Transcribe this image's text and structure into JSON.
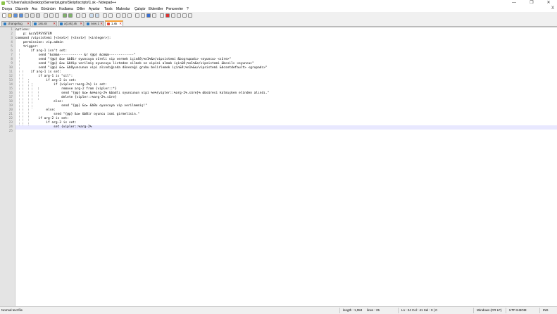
{
  "window": {
    "title": "*C:\\Users\\alica\\Desktop\\Server\\plugins\\Skript\\scripts\\1.sk - Notepad++",
    "minimize": "—",
    "maximize": "❐",
    "close": "✕"
  },
  "menu": {
    "items": [
      "Dosya",
      "Düzenle",
      "Ara",
      "Görünüm",
      "Kodlama",
      "Diller",
      "Ayarlar",
      "Tools",
      "Makrolar",
      "Çalıştır",
      "Eklentiler",
      "Pencereler",
      "?"
    ],
    "close_label": "X"
  },
  "tabs": [
    {
      "label": "changelog"
    },
    {
      "label": "1sk.sk"
    },
    {
      "label": "a(1sk).sk"
    },
    {
      "label": "new 1"
    },
    {
      "label": "1.sk"
    }
  ],
  "editor": {
    "lines": [
      "options:",
      "    p: &ccVIPSYSTEM",
      "command /vipsistemi [<text>] [<text>] [<integer>]:",
      "    permission: vip.admin",
      "    trigger:",
      "        if arg-1 isn't set:",
      "            send \"&cm&m------------ &r {@p} &cm&m-------------\"",
      "            send \"{@p} &c► &bBir oyuncuya süreli vip vermek için&9;%n1%&e/vipsistemi &bcgrupadı> <oyuncu> <süre>\"",
      "            send \"{@p} &c► &bVip verilmiş oyuncuyu listeden silmek ve vipini almak için&9;%n1%&e/vipsistemi &bcsil> <oyuncu>\"",
      "            send \"{@p} &c► &bOyuncunun vipi alındığında döneceği grubu belirlemek için&9;%n1%&e/vipsistemi &bcsetdefault> <grupadı>\"",
      "        if arg-1 is set:",
      "            if arg-1 is \"sil\":",
      "                if arg-2 is set:",
      "                    if {vipler::%arg-2%} is set:",
      "                        remove arg-2 from {vipler::*}",
      "                        send \"{@p} &c► &e%arg-2% &badlı oyuncunun vipi %e%{vipler::%arg-2%.süre}% &bsüresi kalmışken elinden alındı.\"",
      "                        delete {vipler::%arg-2%.süre}",
      "                    else:",
      "                        send \"{@p} &c► &bBu oyuncuya vip verilmemiş!\"",
      "                else:",
      "                    send \"{@p} &c► &bBir oyuncu ismi girmelisin.\"",
      "            if arg-2 is set:",
      "                if arg-3 is set:",
      "                    set {vipler::%arg-2%",
      ""
    ],
    "current_line": 24
  },
  "status": {
    "file_type": "Normal text file",
    "length": "length : 1,084",
    "lines": "lines : 25",
    "position": "Ln : 24    Col : 41    Sel : 0 | 0",
    "eol": "Windows (CR LF)",
    "encoding": "UTF-8-BOM",
    "mode": "INS"
  }
}
